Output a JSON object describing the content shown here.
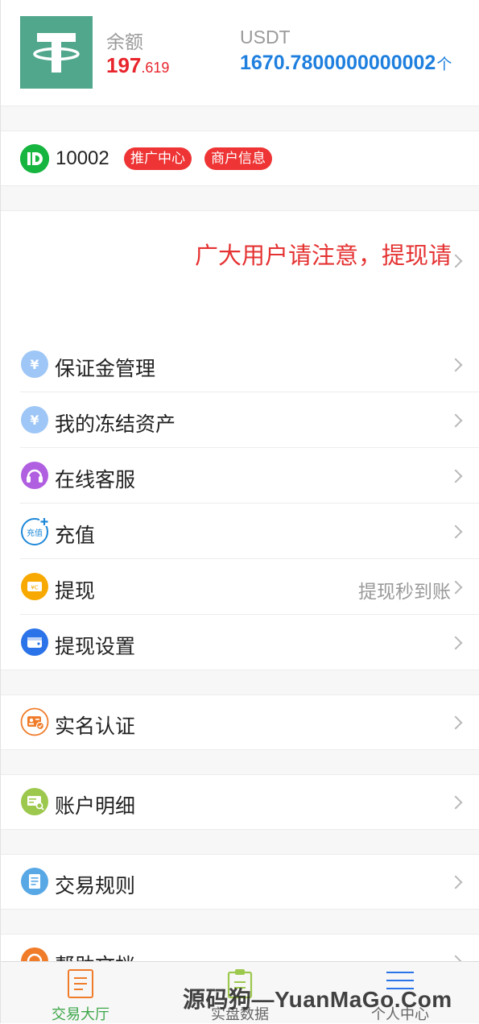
{
  "header": {
    "balance_label": "余额",
    "balance_int": "197",
    "balance_dec": ".619",
    "usdt_label": "USDT",
    "usdt_value": "1670.7800000000002",
    "usdt_unit": "个"
  },
  "account": {
    "id": "10002",
    "promo_label": "推广中心",
    "merchant_label": "商户信息"
  },
  "notice": {
    "text": "广大用户请注意，提现请"
  },
  "menu": [
    {
      "label": "保证金管理",
      "icon": "yuan-coin-icon",
      "color": "#9ec6f6"
    },
    {
      "label": "我的冻结资产",
      "icon": "yuan-coin-icon",
      "color": "#9ec6f6"
    },
    {
      "label": "在线客服",
      "icon": "headset-icon",
      "color": "#b05fe0"
    },
    {
      "label": "充值",
      "icon": "recharge-icon",
      "color": "#1e88d8"
    },
    {
      "label": "提现",
      "icon": "withdraw-icon",
      "color": "#f7a900",
      "extra": "提现秒到账"
    },
    {
      "label": "提现设置",
      "icon": "wallet-icon",
      "color": "#2a73e8"
    },
    {
      "label": "实名认证",
      "icon": "id-card-icon",
      "color": "#f07c2a"
    },
    {
      "label": "账户明细",
      "icon": "statement-icon",
      "color": "#9dc84e"
    },
    {
      "label": "交易规则",
      "icon": "document-icon",
      "color": "#58a8e6"
    },
    {
      "label": "帮助文档",
      "icon": "help-icon",
      "color": "#f07c2a"
    }
  ],
  "tabbar": {
    "tabs": [
      {
        "label": "交易大厅",
        "icon": "document-icon",
        "active": true
      },
      {
        "label": "实盘数据",
        "icon": "clipboard-icon",
        "active": false
      },
      {
        "label": "个人中心",
        "icon": "menu-lines-icon",
        "active": false
      }
    ]
  },
  "watermark": "源码狗—YuanMaGo.Com",
  "colors": {
    "accent_red": "#e8242c",
    "accent_blue": "#1e7fde",
    "accent_green": "#3ea64a",
    "logo_green": "#50a78c"
  }
}
